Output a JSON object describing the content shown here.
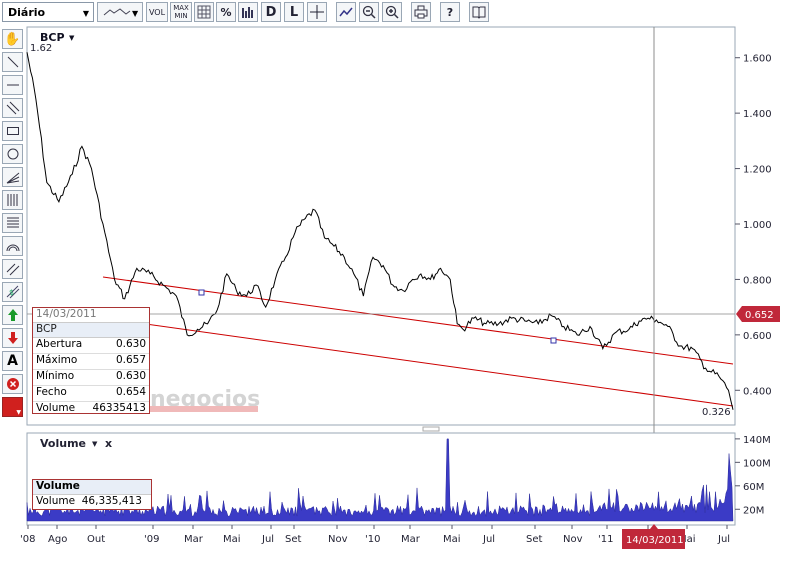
{
  "toolbar": {
    "period_value": "Diário",
    "vol_label": "VOL",
    "maxmin_label": "MAX MIN",
    "percent_label": "%",
    "d_label": "D",
    "l_label": "L",
    "help_label": "?"
  },
  "symbol_menu": {
    "label": "BCP"
  },
  "current_value": "1.62",
  "last_price": "0.652",
  "min_value_label": "0.326",
  "watermark": "negocios",
  "info_box": {
    "date": "14/03/2011",
    "symbol": "BCP",
    "rows": [
      {
        "label": "Abertura",
        "value": "0.630"
      },
      {
        "label": "Máximo",
        "value": "0.657"
      },
      {
        "label": "Mínimo",
        "value": "0.630"
      },
      {
        "label": "Fecho",
        "value": "0.654"
      },
      {
        "label": "Volume",
        "value": "46335413"
      }
    ]
  },
  "volume_panel": {
    "title": "Volume",
    "close": "x",
    "box_title": "Volume",
    "box_label": "Volume",
    "box_value": "46,335,413"
  },
  "cursor_date": "14/03/2011",
  "colors": {
    "price_line": "#000000",
    "trend": "#cc0000",
    "volume_fill": "#3b3bc6",
    "badge": "#c0283a"
  },
  "chart_data": [
    {
      "type": "line",
      "series": [
        {
          "name": "BCP",
          "x": [
            "2008-07-01",
            "2008-07-15",
            "2008-08-01",
            "2008-08-20",
            "2008-09-10",
            "2008-09-25",
            "2008-10-10",
            "2008-10-28",
            "2008-11-15",
            "2008-12-01",
            "2008-12-20",
            "2009-01-10",
            "2009-01-30",
            "2009-02-20",
            "2009-03-09",
            "2009-03-25",
            "2009-04-10",
            "2009-04-25",
            "2009-05-10",
            "2009-05-25",
            "2009-06-10",
            "2009-06-25",
            "2009-07-10",
            "2009-07-25",
            "2009-08-10",
            "2009-08-25",
            "2009-09-10",
            "2009-09-25",
            "2009-10-10",
            "2009-10-25",
            "2009-11-10",
            "2009-11-25",
            "2009-12-10",
            "2009-12-25",
            "2010-01-10",
            "2010-01-25",
            "2010-02-10",
            "2010-02-25",
            "2010-03-10",
            "2010-03-25",
            "2010-04-10",
            "2010-04-25",
            "2010-05-06",
            "2010-05-15",
            "2010-06-01",
            "2010-06-20",
            "2010-07-10",
            "2010-07-30",
            "2010-08-20",
            "2010-09-10",
            "2010-09-30",
            "2010-10-20",
            "2010-11-10",
            "2010-11-30",
            "2010-12-20",
            "2011-01-10",
            "2011-01-30",
            "2011-02-15",
            "2011-03-01",
            "2011-03-14",
            "2011-04-01",
            "2011-04-20",
            "2011-05-10",
            "2011-05-30",
            "2011-06-20",
            "2011-07-05",
            "2011-07-12"
          ],
          "values": [
            1.62,
            1.45,
            1.15,
            1.08,
            1.18,
            1.28,
            1.2,
            1.0,
            0.8,
            0.73,
            0.84,
            0.82,
            0.78,
            0.74,
            0.6,
            0.62,
            0.64,
            0.69,
            0.82,
            0.76,
            0.74,
            0.78,
            0.7,
            0.8,
            0.88,
            0.97,
            1.02,
            1.05,
            0.95,
            0.92,
            0.88,
            0.82,
            0.74,
            0.88,
            0.85,
            0.78,
            0.76,
            0.8,
            0.82,
            0.8,
            0.84,
            0.8,
            0.64,
            0.62,
            0.66,
            0.64,
            0.64,
            0.66,
            0.65,
            0.64,
            0.67,
            0.63,
            0.6,
            0.63,
            0.55,
            0.61,
            0.62,
            0.65,
            0.66,
            0.654,
            0.63,
            0.56,
            0.55,
            0.48,
            0.45,
            0.4,
            0.33
          ]
        }
      ],
      "y_ticks": [
        "1.600",
        "1.400",
        "1.200",
        "1.000",
        "0.800",
        "0.600",
        "0.400"
      ],
      "ylim": [
        0.3,
        1.7
      ],
      "x_tick_labels": [
        "'08",
        "Ago",
        "Out",
        "'09",
        "Mar",
        "Mai",
        "Jul",
        "Set",
        "Nov",
        "'10",
        "Mar",
        "Mai",
        "Jul",
        "Set",
        "Nov",
        "'11",
        "Mar",
        "Mai",
        "Jul"
      ],
      "grid": false
    },
    {
      "type": "area",
      "series": [
        {
          "name": "Volume"
        }
      ],
      "y_ticks": [
        "140M",
        "100M",
        "60M",
        "20M"
      ],
      "ylim": [
        0,
        150
      ],
      "grid": false
    }
  ]
}
